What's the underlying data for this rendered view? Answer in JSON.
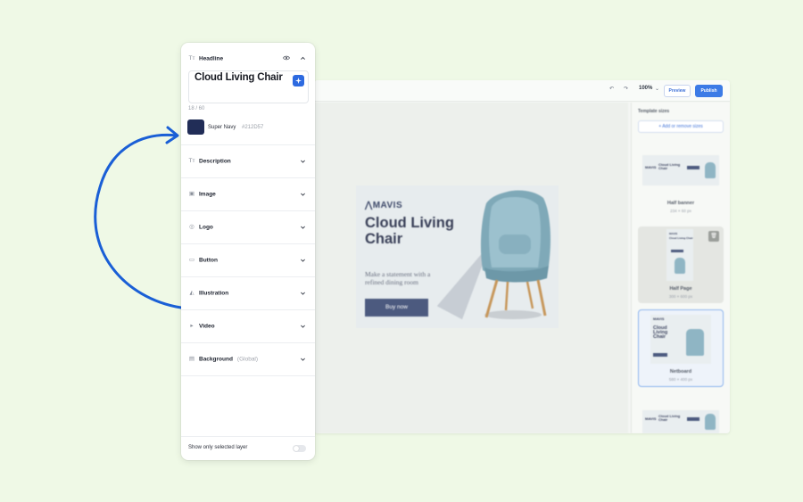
{
  "editor": {
    "toolbar": {
      "undo_icon": "undo-icon",
      "redo_icon": "redo-icon",
      "zoom": "100%",
      "preview_label": "Preview",
      "publish_label": "Publish",
      "publish_color": "#3c7be6"
    },
    "creative": {
      "brand": "MAVIS",
      "headline": "Cloud Living Chair",
      "description": "Make a statement with a refined dining room",
      "button_label": "Buy now"
    },
    "template_sizes": {
      "title": "Template sizes",
      "add_label": "+ Add or remove sizes",
      "cards": [
        {
          "name": "Half banner",
          "dims": "234 × 60 px",
          "state": "default"
        },
        {
          "name": "Half Page",
          "dims": "300 × 600 px",
          "state": "hover"
        },
        {
          "name": "Netboard",
          "dims": "580 × 400 px",
          "state": "selected"
        },
        {
          "name": "",
          "dims": "",
          "state": "default"
        }
      ]
    }
  },
  "layers_panel": {
    "headline": {
      "label": "Headline",
      "value": "Cloud Living Chair",
      "counter": "18 / 60",
      "color_name": "Super Navy",
      "color_hex": "#212D57"
    },
    "sections": [
      {
        "label": "Description",
        "icon": "text-icon",
        "sub": ""
      },
      {
        "label": "Image",
        "icon": "image-icon",
        "sub": ""
      },
      {
        "label": "Logo",
        "icon": "logo-icon",
        "sub": ""
      },
      {
        "label": "Button",
        "icon": "button-icon",
        "sub": ""
      },
      {
        "label": "Illustration",
        "icon": "illustration-icon",
        "sub": ""
      },
      {
        "label": "Video",
        "icon": "video-icon",
        "sub": ""
      },
      {
        "label": "Background",
        "icon": "background-icon",
        "sub": "(Global)"
      }
    ],
    "footer": {
      "show_selected_label": "Show only selected layer",
      "toggle_on": false
    }
  },
  "colors": {
    "background": "#eff9e6",
    "accent": "#2d6ae0",
    "arrow": "#1a5fd6",
    "swatch": "#212d57"
  }
}
